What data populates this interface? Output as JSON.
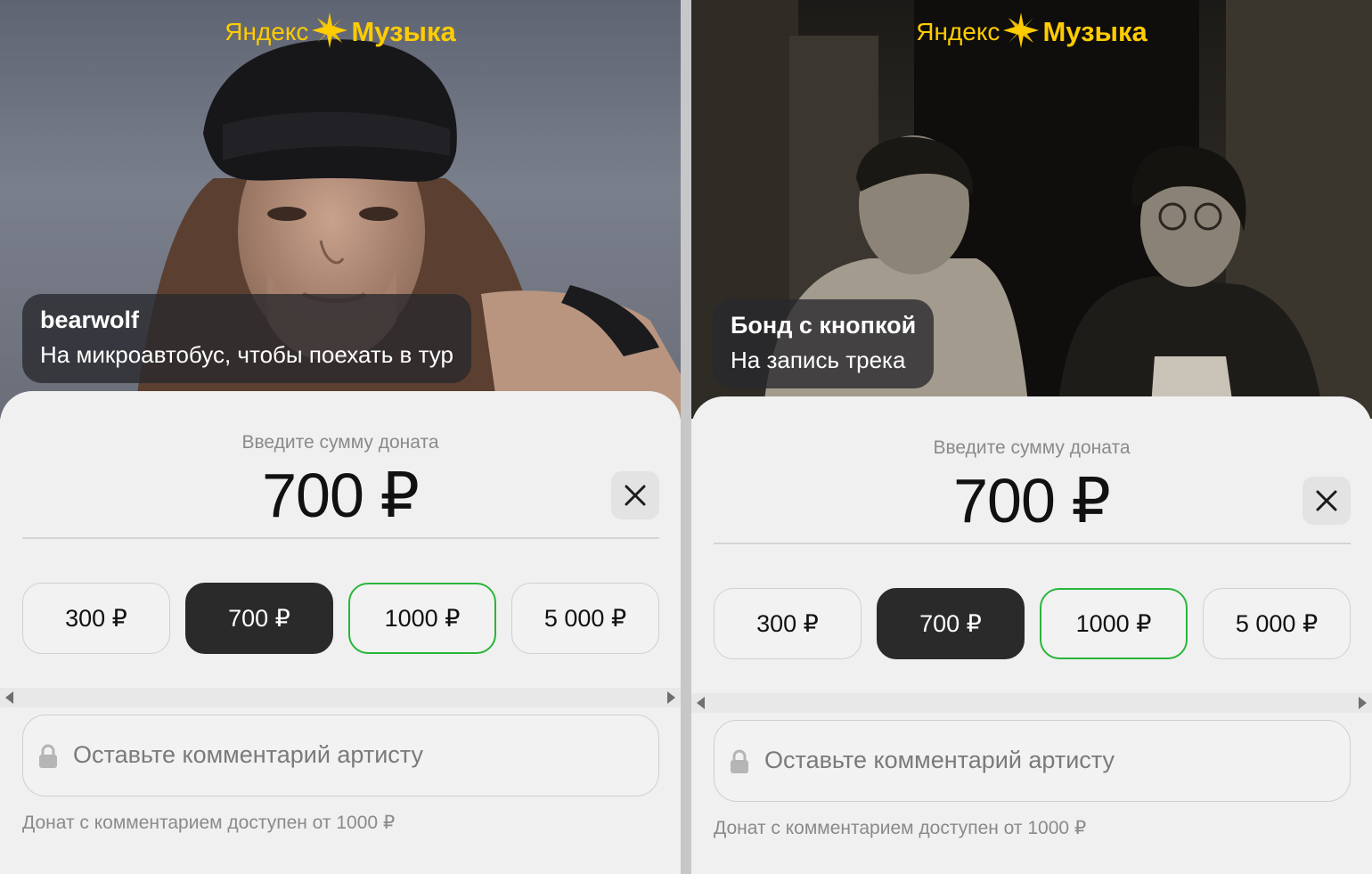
{
  "brand": {
    "part1": "Яндекс",
    "part2": "Музыка",
    "color": "#ffcc00"
  },
  "screens": [
    {
      "artist": "bearwolf",
      "goal": "На микроавтобус, чтобы поехать в тур",
      "amount_label": "Введите сумму доната",
      "amount_value": "700 ₽",
      "presets": [
        "300 ₽",
        "700 ₽",
        "1000 ₽",
        "5 000 ₽"
      ],
      "selected_preset": "700 ₽",
      "highlighted_preset": "1000 ₽",
      "comment_placeholder": "Оставьте комментарий артисту",
      "comment_hint": "Донат с комментарием доступен от 1000 ₽"
    },
    {
      "artist": "Бонд с кнопкой",
      "goal": "На запись трека",
      "amount_label": "Введите сумму доната",
      "amount_value": "700 ₽",
      "presets": [
        "300 ₽",
        "700 ₽",
        "1000 ₽",
        "5 000 ₽"
      ],
      "selected_preset": "700 ₽",
      "highlighted_preset": "1000 ₽",
      "comment_placeholder": "Оставьте комментарий артисту",
      "comment_hint": "Донат с комментарием доступен от 1000 ₽"
    }
  ],
  "colors": {
    "selected_chip": "#2a2a2a",
    "highlight_border": "#29b53a"
  },
  "icons": {
    "close": "close-icon",
    "lock": "lock-icon",
    "logo_star": "yandex-star-icon"
  }
}
